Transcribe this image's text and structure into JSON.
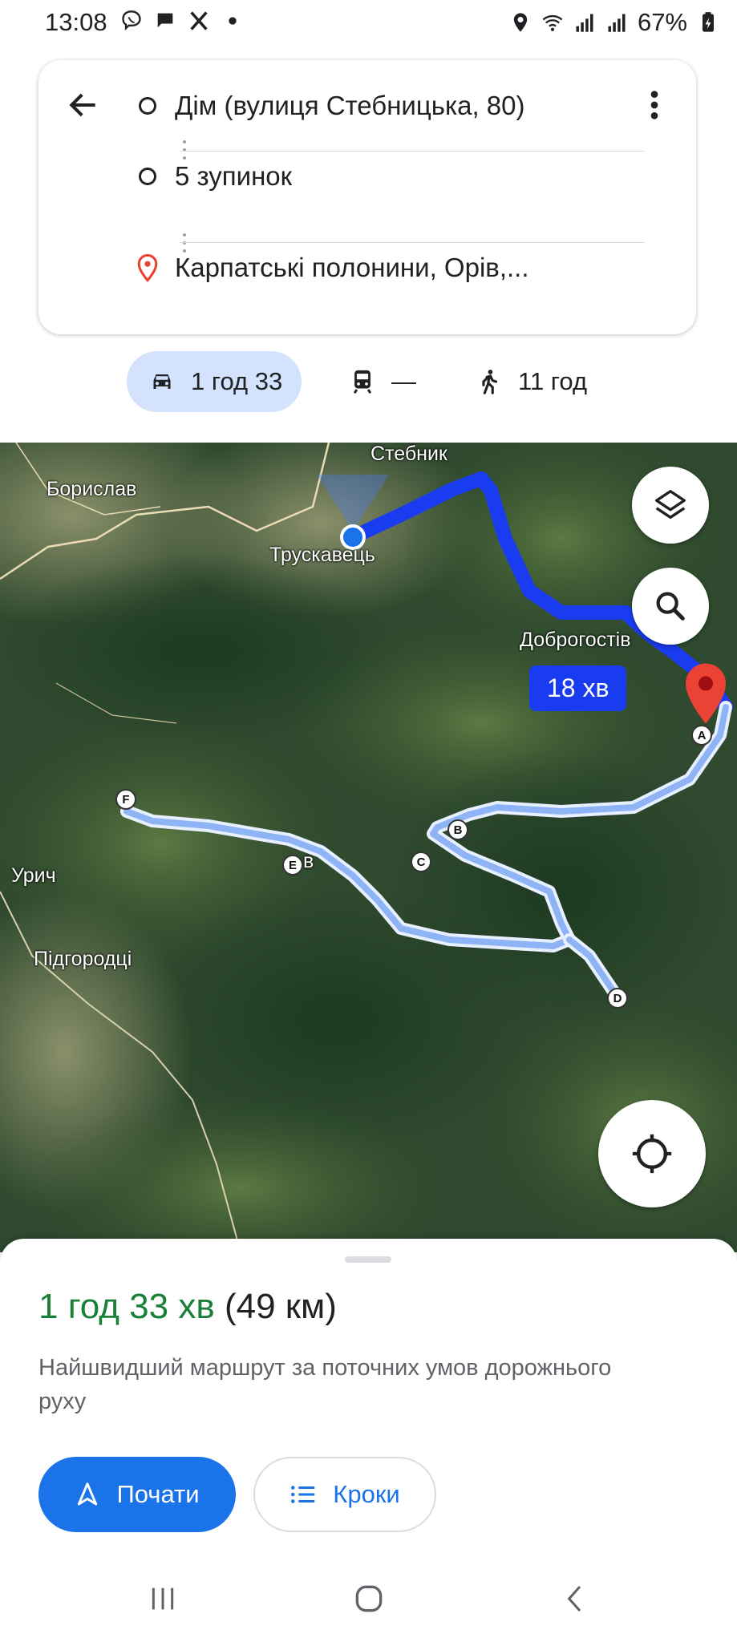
{
  "status_bar": {
    "time": "13:08",
    "battery": "67%",
    "left_icons": [
      "viber-icon",
      "chat-icon",
      "x-icon",
      "dot-icon"
    ],
    "right_icons": [
      "location-icon",
      "wifi-icon",
      "signal-icon",
      "signal-icon",
      "battery-icon"
    ]
  },
  "route": {
    "origin": "Дім (вулиця Стебницька, 80)",
    "stops": "5 зупинок",
    "destination": "Карпатські полонини, Орів,..."
  },
  "modes": {
    "drive": "1 год 33",
    "transit": "—",
    "walk": "11 год"
  },
  "map": {
    "labels": {
      "stebnyk": "Стебник",
      "boryslav": "Борислав",
      "truskavets": "Трускавець",
      "dobrohostiv": "Доброгостів",
      "urych": "Урич",
      "pidhorodtsi": "Підгородці",
      "oriv_partial": "в"
    },
    "time_bubble": "18 хв",
    "stop_letters": [
      "A",
      "B",
      "C",
      "D",
      "E",
      "F"
    ],
    "route_color": "#1a3cf0",
    "pin_color": "#ea4335"
  },
  "sheet": {
    "duration": "1 год 33 хв",
    "distance": "(49 км)",
    "description": "Найшвидший маршрут за поточних умов дорожнього руху",
    "start_label": "Почати",
    "steps_label": "Кроки"
  }
}
